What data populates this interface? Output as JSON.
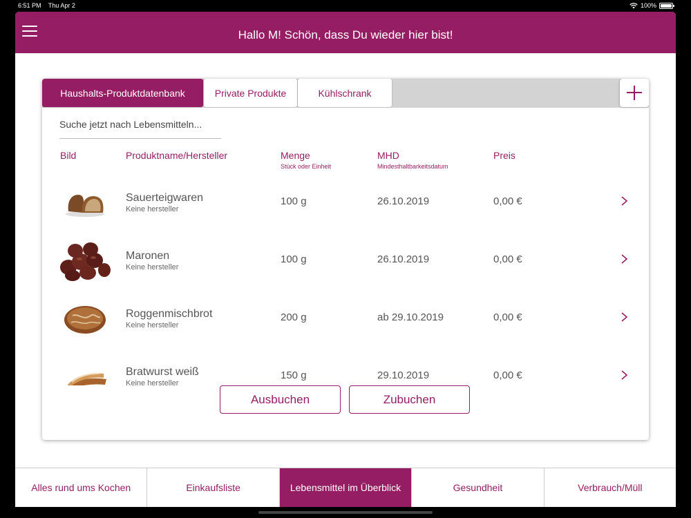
{
  "status_bar": {
    "time": "6:51 PM",
    "date": "Thu Apr 2",
    "battery": "100%"
  },
  "header": {
    "title": "Hallo M! Schön, dass Du wieder hier bist!"
  },
  "tabs": [
    {
      "label": "Haushalts-Produktdatenbank",
      "active": true
    },
    {
      "label": "Private Produkte",
      "active": false
    },
    {
      "label": "Kühlschrank",
      "active": false
    }
  ],
  "search": {
    "placeholder": "Suche jetzt nach Lebensmitteln..."
  },
  "columns": {
    "bild": "Bild",
    "name": "Produktname/Hersteller",
    "menge": "Menge",
    "menge_sub": "Stück oder Einheit",
    "mhd": "MHD",
    "mhd_sub": "Mindesthaltbarkeitsdatum",
    "preis": "Preis"
  },
  "products": [
    {
      "name": "Sauerteigwaren",
      "maker": "Keine hersteller",
      "menge": "100 g",
      "mhd": "26.10.2019",
      "preis": "0,00 €",
      "image": "bread-slice-image"
    },
    {
      "name": "Maronen",
      "maker": "Keine hersteller",
      "menge": "100 g",
      "mhd": "26.10.2019",
      "preis": "0,00 €",
      "image": "chestnuts-image"
    },
    {
      "name": "Roggenmischbrot",
      "maker": "Keine hersteller",
      "menge": "200 g",
      "mhd": "ab 29.10.2019",
      "preis": "0,00 €",
      "image": "round-bread-image"
    },
    {
      "name": "Bratwurst weiß",
      "maker": "Keine hersteller",
      "menge": "150 g",
      "mhd": "29.10.2019",
      "preis": "0,00 €",
      "image": "bratwurst-image"
    }
  ],
  "actions": {
    "ausbuchen": "Ausbuchen",
    "zubuchen": "Zubuchen"
  },
  "bottom_nav": [
    {
      "label": "Alles rund ums Kochen",
      "active": false
    },
    {
      "label": "Einkaufsliste",
      "active": false
    },
    {
      "label": "Lebensmittel im Überblick",
      "active": true
    },
    {
      "label": "Gesundheit",
      "active": false
    },
    {
      "label": "Verbrauch/Müll",
      "active": false
    }
  ],
  "colors": {
    "brand": "#951d63",
    "tabbar_bg": "#d3d3d3"
  }
}
